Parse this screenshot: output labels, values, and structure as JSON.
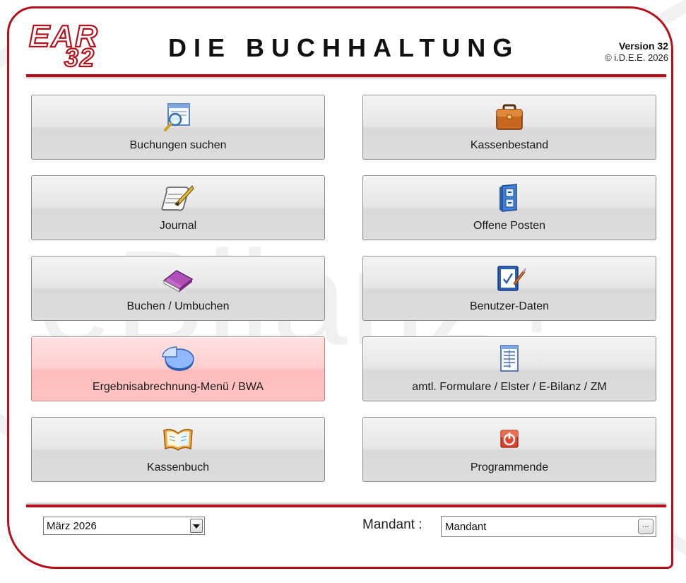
{
  "header": {
    "logo_text": "EAR 32",
    "title": "DIE BUCHHALTUNG",
    "version": "Version 32",
    "copyright": "© i.D.E.E. 2026"
  },
  "watermark": "eBilanz+",
  "menu": {
    "left": [
      {
        "label": "Buchungen suchen",
        "icon": "search-document-icon"
      },
      {
        "label": "Journal",
        "icon": "quill-scroll-icon"
      },
      {
        "label": "Buchen / Umbuchen",
        "icon": "book-icon"
      },
      {
        "label": "Ergebnisabrechnung-Menü / BWA",
        "icon": "pie-chart-icon"
      },
      {
        "label": "Kassenbuch",
        "icon": "open-book-icon"
      }
    ],
    "right": [
      {
        "label": "Kassenbestand",
        "icon": "briefcase-icon"
      },
      {
        "label": "Offene Posten",
        "icon": "cabinet-icon"
      },
      {
        "label": "Benutzer-Daten",
        "icon": "clipboard-pen-icon"
      },
      {
        "label": "amtl. Formulare / Elster / E-Bilanz / ZM",
        "icon": "form-document-icon"
      },
      {
        "label": "Programmende",
        "icon": "power-icon"
      }
    ]
  },
  "footer": {
    "period": "März 2026",
    "mandant_label": "Mandant :",
    "mandant_value": "Mandant",
    "browse_label": "..."
  },
  "colors": {
    "accent": "#b5101a",
    "active_button": "#ffc8c8"
  }
}
